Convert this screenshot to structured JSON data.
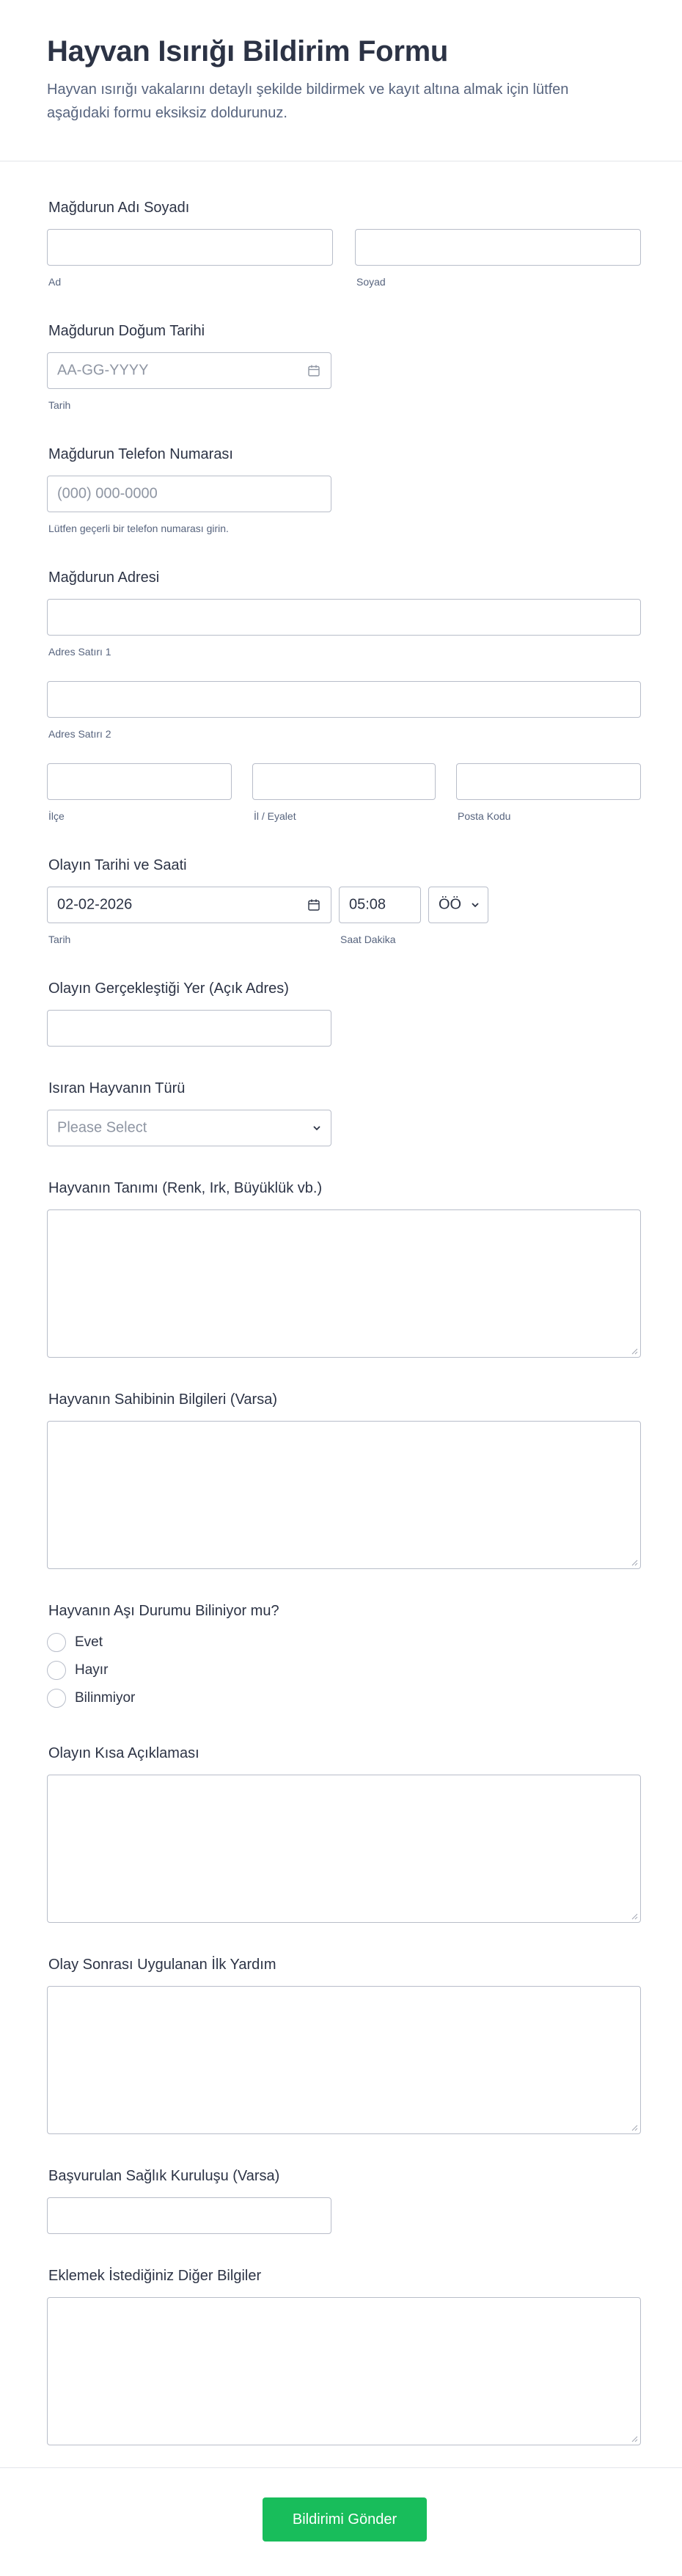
{
  "header": {
    "title": "Hayvan Isırığı Bildirim Formu",
    "subtitle": "Hayvan ısırığı vakalarını detaylı şekilde bildirmek ve kayıt altına almak için lütfen aşağıdaki formu eksiksiz doldurunuz."
  },
  "victim_name": {
    "label": "Mağdurun Adı Soyadı",
    "first_sub": "Ad",
    "last_sub": "Soyad"
  },
  "birth_date": {
    "label": "Mağdurun Doğum Tarihi",
    "placeholder": "AA-GG-YYYY",
    "sub": "Tarih",
    "icon": "calendar-icon"
  },
  "phone": {
    "label": "Mağdurun Telefon Numarası",
    "placeholder": "(000) 000-0000",
    "sub": "Lütfen geçerli bir telefon numarası girin."
  },
  "address": {
    "label": "Mağdurun Adresi",
    "line1_sub": "Adres Satırı 1",
    "line2_sub": "Adres Satırı 2",
    "district_sub": "İlçe",
    "province_sub": "İl / Eyalet",
    "postal_sub": "Posta Kodu"
  },
  "incident_datetime": {
    "label": "Olayın Tarihi ve Saati",
    "date_value": "02-02-2026",
    "date_sub": "Tarih",
    "time_value": "05:08",
    "time_sub": "Saat Dakika",
    "ampm_value": "ÖÖ"
  },
  "location": {
    "label": "Olayın Gerçekleştiği Yer (Açık Adres)"
  },
  "animal_type": {
    "label": "Isıran Hayvanın Türü",
    "placeholder": "Please Select"
  },
  "animal_description": {
    "label": "Hayvanın Tanımı (Renk, Irk, Büyüklük vb.)"
  },
  "owner_info": {
    "label": "Hayvanın Sahibinin Bilgileri (Varsa)"
  },
  "vaccination": {
    "label": "Hayvanın Aşı Durumu Biliniyor mu?",
    "options": [
      "Evet",
      "Hayır",
      "Bilinmiyor"
    ]
  },
  "incident_summary": {
    "label": "Olayın Kısa Açıklaması"
  },
  "first_aid": {
    "label": "Olay Sonrası Uygulanan İlk Yardım"
  },
  "health_institution": {
    "label": "Başvurulan Sağlık Kuruluşu (Varsa)"
  },
  "other_info": {
    "label": "Eklemek İstediğiniz Diğer Bilgiler"
  },
  "submit": {
    "label": "Bildirimi Gönder"
  }
}
